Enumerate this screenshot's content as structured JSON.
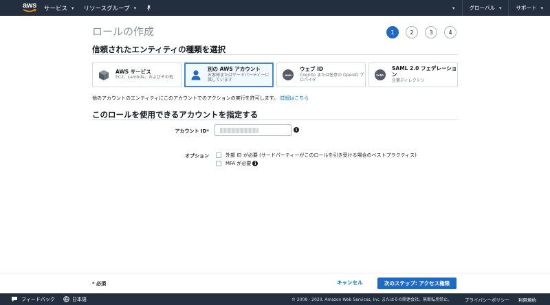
{
  "nav": {
    "logo_text": "aws",
    "services_label": "サービス",
    "resource_groups_label": "リソースグループ",
    "global_label": "グローバル",
    "support_label": "サポート"
  },
  "page": {
    "title": "ロールの作成",
    "steps": [
      "1",
      "2",
      "3",
      "4"
    ],
    "active_step": 1
  },
  "trusted_entity": {
    "section_title": "信頼されたエンティティの種類を選択",
    "cards": [
      {
        "title": "AWS サービス",
        "subtitle": "EC2、Lambda、およびその他",
        "icon": "cube-icon",
        "selected": false
      },
      {
        "title": "別の AWS アカウント",
        "subtitle": "お客様またはサードパーティーに属しています",
        "icon": "user-icon",
        "selected": true
      },
      {
        "title": "ウェブ ID",
        "subtitle": "Cognito または任意の OpenID プロバイダ",
        "icon": "www-icon",
        "icon_text": "www",
        "selected": false
      },
      {
        "title": "SAML 2.0 フェデレーション",
        "subtitle": "企業ディレクトリ",
        "icon": "saml-icon",
        "icon_text": "SAML",
        "selected": false
      }
    ],
    "description": "他のアカウントのエンティティにこのアカウントでのアクションの実行を許可します。",
    "learn_more": "詳細はこちら"
  },
  "account": {
    "section_title": "このロールを使用できるアカウントを指定する",
    "account_id_label": "アカウント ID*",
    "account_id_value": "",
    "options_label": "オプション",
    "option_external_id": "外部 ID が必要 (サードパーティーがこのロールを引き受ける場合のベストプラクティス)",
    "option_mfa": "MFA が必要"
  },
  "actions": {
    "required_note": "* 必須",
    "cancel_label": "キャンセル",
    "next_label": "次のステップ: アクセス権限"
  },
  "footer": {
    "feedback_label": "フィードバック",
    "language_label": "日本語",
    "copyright": "© 2008 - 2020, Amazon Web Services, Inc. またはその関連会社。無断転用禁止。",
    "privacy_label": "プライバシーポリシー",
    "terms_label": "利用規約"
  },
  "colors": {
    "nav_bg": "#232f3e",
    "primary": "#1f6bc4",
    "link": "#0073bb",
    "selected_border": "#3f88d0"
  }
}
